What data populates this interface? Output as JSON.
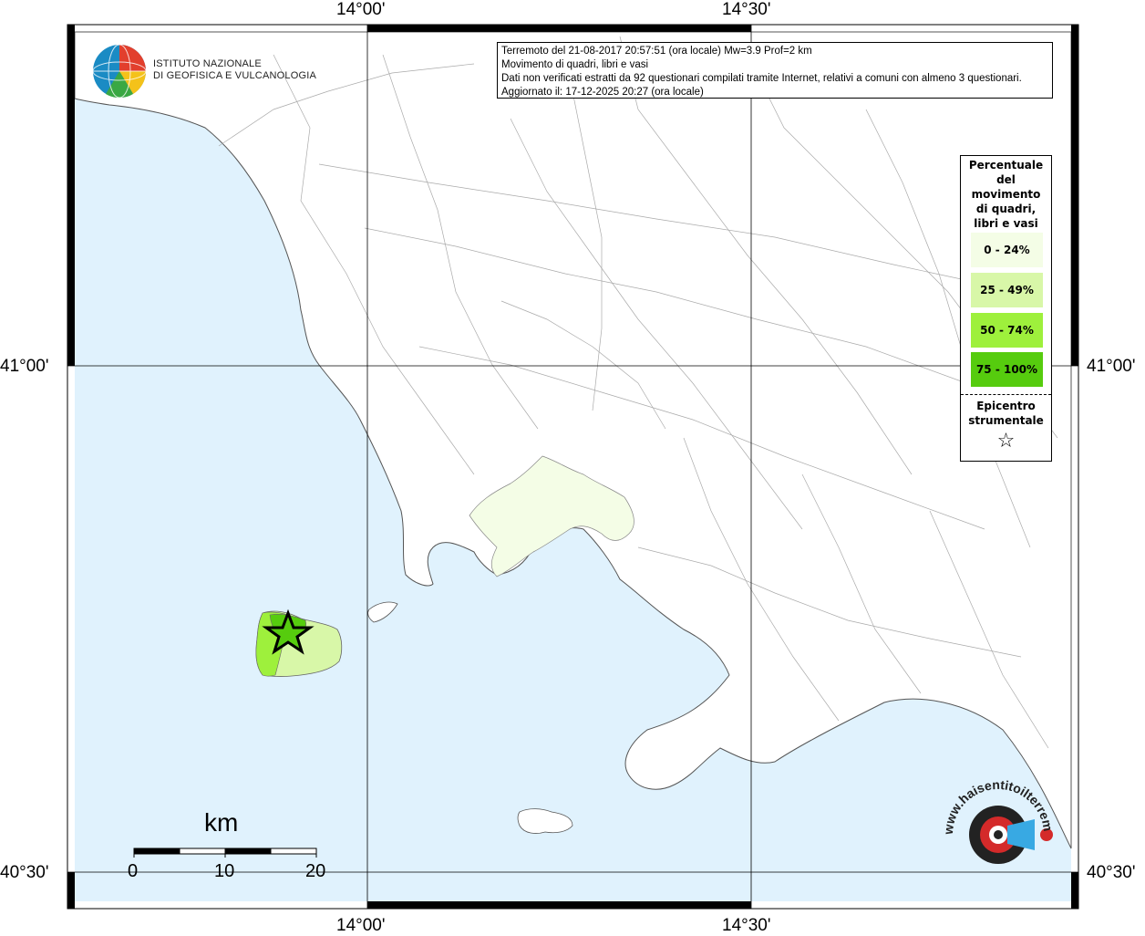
{
  "map": {
    "axes": {
      "top": [
        "14°00'",
        "14°30'"
      ],
      "bottom": [
        "14°00'",
        "14°30'"
      ],
      "left": [
        "41°00'",
        "40°30'"
      ],
      "right": [
        "41°00'",
        "40°30'"
      ]
    },
    "colors": {
      "sea": "#e0f2fd",
      "land": "#ffffff",
      "class_0_24": "#f4fde6",
      "class_25_49": "#d8f7a8",
      "class_50_74": "#9ef03c",
      "class_75_100": "#56cc0e"
    }
  },
  "info": {
    "line1": "Terremoto del 21-08-2017 20:57:51 (ora locale) Mw=3.9 Prof=2 km",
    "line2": "Movimento di quadri, libri e vasi",
    "line3": "Dati non verificati estratti da 92 questionari compilati tramite Internet, relativi a comuni con almeno 3 questionari.",
    "line4": "Aggiornato il: 17-12-2025 20:27 (ora locale)"
  },
  "legend": {
    "title": [
      "Percentuale",
      "del",
      "movimento",
      "di quadri,",
      "libri e vasi"
    ],
    "classes": [
      "0 - 24%",
      "25 - 49%",
      "50 - 74%",
      "75 - 100%"
    ],
    "epicenter_label": [
      "Epicentro",
      "strumentale"
    ],
    "epicenter_symbol": "☆"
  },
  "logo": {
    "line1": "ISTITUTO NAZIONALE",
    "line2": "DI GEOFISICA E VULCANOLOGIA",
    "icon": "ingv-globe-icon"
  },
  "scalebar": {
    "unit": "km",
    "ticks": [
      "0",
      "10",
      "20"
    ]
  },
  "badge": {
    "text": "www.haisentitoilterremoto.it",
    "icon": "loudspeaker-icon"
  }
}
